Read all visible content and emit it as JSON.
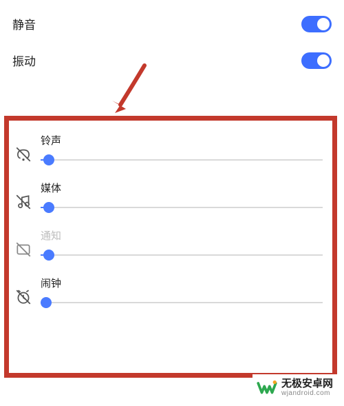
{
  "top": {
    "mute": {
      "label": "静音",
      "on": true
    },
    "vibrate": {
      "label": "振动",
      "on": true
    }
  },
  "sliders": {
    "ringtone": {
      "label": "铃声",
      "value": 3,
      "disabled": false,
      "icon": "bell-off-icon"
    },
    "media": {
      "label": "媒体",
      "value": 3,
      "disabled": false,
      "icon": "note-off-icon"
    },
    "notify": {
      "label": "通知",
      "value": 3,
      "disabled": true,
      "icon": "message-off-icon"
    },
    "alarm": {
      "label": "闹钟",
      "value": 2,
      "disabled": false,
      "icon": "clock-off-icon"
    }
  },
  "annotation": {
    "type": "arrow",
    "color": "#c3392c"
  },
  "watermark": {
    "brand": "无极安卓网",
    "url": "wjandroid.com"
  },
  "colors": {
    "accent": "#4a7bff",
    "highlight": "#c3392c"
  }
}
